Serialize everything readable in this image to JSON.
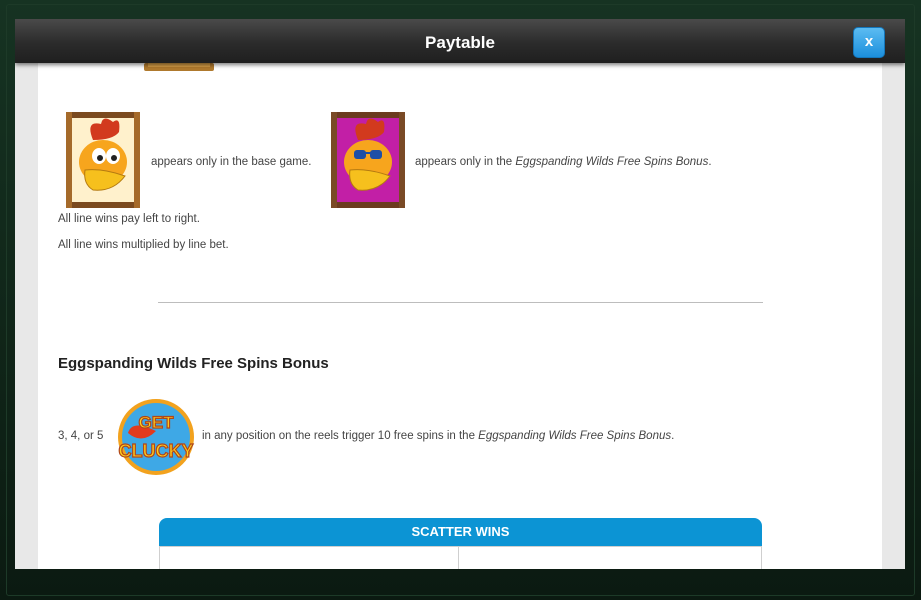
{
  "modal": {
    "title": "Paytable",
    "close_label": "x"
  },
  "symbols": {
    "base_text": "appears only in the base game.",
    "bonus_prefix": "appears only in the ",
    "bonus_name": "Eggspanding Wilds Free Spins Bonus",
    "period": "."
  },
  "rules": [
    "All line wins pay left to right.",
    "All line wins multiplied by line bet."
  ],
  "bonus_section": {
    "title": "Eggspanding Wilds Free Spins Bonus",
    "count_text": "3, 4, or 5",
    "trigger_text": "in any position on the reels trigger 10 free spins in the ",
    "bonus_name": "Eggspanding Wilds Free Spins Bonus",
    "period": ".",
    "scatter_logo_line1": "GET",
    "scatter_logo_line2": "CLUCKY"
  },
  "scatter_table": {
    "header": "SCATTER WINS"
  },
  "colors": {
    "accent": "#0c94d4",
    "header_dark": "#2b2b2b",
    "close_button": "#1c8fdc"
  }
}
